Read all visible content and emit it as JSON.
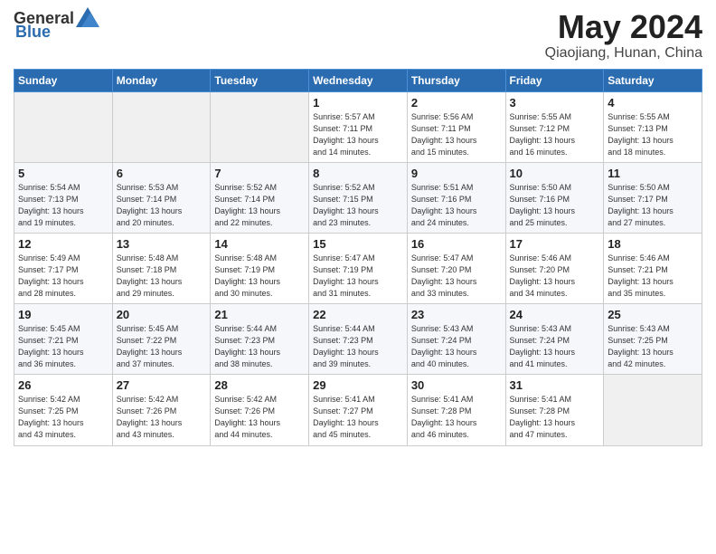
{
  "header": {
    "logo_general": "General",
    "logo_blue": "Blue",
    "title": "May 2024",
    "subtitle": "Qiaojiang, Hunan, China"
  },
  "weekdays": [
    "Sunday",
    "Monday",
    "Tuesday",
    "Wednesday",
    "Thursday",
    "Friday",
    "Saturday"
  ],
  "weeks": [
    [
      {
        "day": "",
        "info": ""
      },
      {
        "day": "",
        "info": ""
      },
      {
        "day": "",
        "info": ""
      },
      {
        "day": "1",
        "info": "Sunrise: 5:57 AM\nSunset: 7:11 PM\nDaylight: 13 hours\nand 14 minutes."
      },
      {
        "day": "2",
        "info": "Sunrise: 5:56 AM\nSunset: 7:11 PM\nDaylight: 13 hours\nand 15 minutes."
      },
      {
        "day": "3",
        "info": "Sunrise: 5:55 AM\nSunset: 7:12 PM\nDaylight: 13 hours\nand 16 minutes."
      },
      {
        "day": "4",
        "info": "Sunrise: 5:55 AM\nSunset: 7:13 PM\nDaylight: 13 hours\nand 18 minutes."
      }
    ],
    [
      {
        "day": "5",
        "info": "Sunrise: 5:54 AM\nSunset: 7:13 PM\nDaylight: 13 hours\nand 19 minutes."
      },
      {
        "day": "6",
        "info": "Sunrise: 5:53 AM\nSunset: 7:14 PM\nDaylight: 13 hours\nand 20 minutes."
      },
      {
        "day": "7",
        "info": "Sunrise: 5:52 AM\nSunset: 7:14 PM\nDaylight: 13 hours\nand 22 minutes."
      },
      {
        "day": "8",
        "info": "Sunrise: 5:52 AM\nSunset: 7:15 PM\nDaylight: 13 hours\nand 23 minutes."
      },
      {
        "day": "9",
        "info": "Sunrise: 5:51 AM\nSunset: 7:16 PM\nDaylight: 13 hours\nand 24 minutes."
      },
      {
        "day": "10",
        "info": "Sunrise: 5:50 AM\nSunset: 7:16 PM\nDaylight: 13 hours\nand 25 minutes."
      },
      {
        "day": "11",
        "info": "Sunrise: 5:50 AM\nSunset: 7:17 PM\nDaylight: 13 hours\nand 27 minutes."
      }
    ],
    [
      {
        "day": "12",
        "info": "Sunrise: 5:49 AM\nSunset: 7:17 PM\nDaylight: 13 hours\nand 28 minutes."
      },
      {
        "day": "13",
        "info": "Sunrise: 5:48 AM\nSunset: 7:18 PM\nDaylight: 13 hours\nand 29 minutes."
      },
      {
        "day": "14",
        "info": "Sunrise: 5:48 AM\nSunset: 7:19 PM\nDaylight: 13 hours\nand 30 minutes."
      },
      {
        "day": "15",
        "info": "Sunrise: 5:47 AM\nSunset: 7:19 PM\nDaylight: 13 hours\nand 31 minutes."
      },
      {
        "day": "16",
        "info": "Sunrise: 5:47 AM\nSunset: 7:20 PM\nDaylight: 13 hours\nand 33 minutes."
      },
      {
        "day": "17",
        "info": "Sunrise: 5:46 AM\nSunset: 7:20 PM\nDaylight: 13 hours\nand 34 minutes."
      },
      {
        "day": "18",
        "info": "Sunrise: 5:46 AM\nSunset: 7:21 PM\nDaylight: 13 hours\nand 35 minutes."
      }
    ],
    [
      {
        "day": "19",
        "info": "Sunrise: 5:45 AM\nSunset: 7:21 PM\nDaylight: 13 hours\nand 36 minutes."
      },
      {
        "day": "20",
        "info": "Sunrise: 5:45 AM\nSunset: 7:22 PM\nDaylight: 13 hours\nand 37 minutes."
      },
      {
        "day": "21",
        "info": "Sunrise: 5:44 AM\nSunset: 7:23 PM\nDaylight: 13 hours\nand 38 minutes."
      },
      {
        "day": "22",
        "info": "Sunrise: 5:44 AM\nSunset: 7:23 PM\nDaylight: 13 hours\nand 39 minutes."
      },
      {
        "day": "23",
        "info": "Sunrise: 5:43 AM\nSunset: 7:24 PM\nDaylight: 13 hours\nand 40 minutes."
      },
      {
        "day": "24",
        "info": "Sunrise: 5:43 AM\nSunset: 7:24 PM\nDaylight: 13 hours\nand 41 minutes."
      },
      {
        "day": "25",
        "info": "Sunrise: 5:43 AM\nSunset: 7:25 PM\nDaylight: 13 hours\nand 42 minutes."
      }
    ],
    [
      {
        "day": "26",
        "info": "Sunrise: 5:42 AM\nSunset: 7:25 PM\nDaylight: 13 hours\nand 43 minutes."
      },
      {
        "day": "27",
        "info": "Sunrise: 5:42 AM\nSunset: 7:26 PM\nDaylight: 13 hours\nand 43 minutes."
      },
      {
        "day": "28",
        "info": "Sunrise: 5:42 AM\nSunset: 7:26 PM\nDaylight: 13 hours\nand 44 minutes."
      },
      {
        "day": "29",
        "info": "Sunrise: 5:41 AM\nSunset: 7:27 PM\nDaylight: 13 hours\nand 45 minutes."
      },
      {
        "day": "30",
        "info": "Sunrise: 5:41 AM\nSunset: 7:28 PM\nDaylight: 13 hours\nand 46 minutes."
      },
      {
        "day": "31",
        "info": "Sunrise: 5:41 AM\nSunset: 7:28 PM\nDaylight: 13 hours\nand 47 minutes."
      },
      {
        "day": "",
        "info": ""
      }
    ]
  ]
}
